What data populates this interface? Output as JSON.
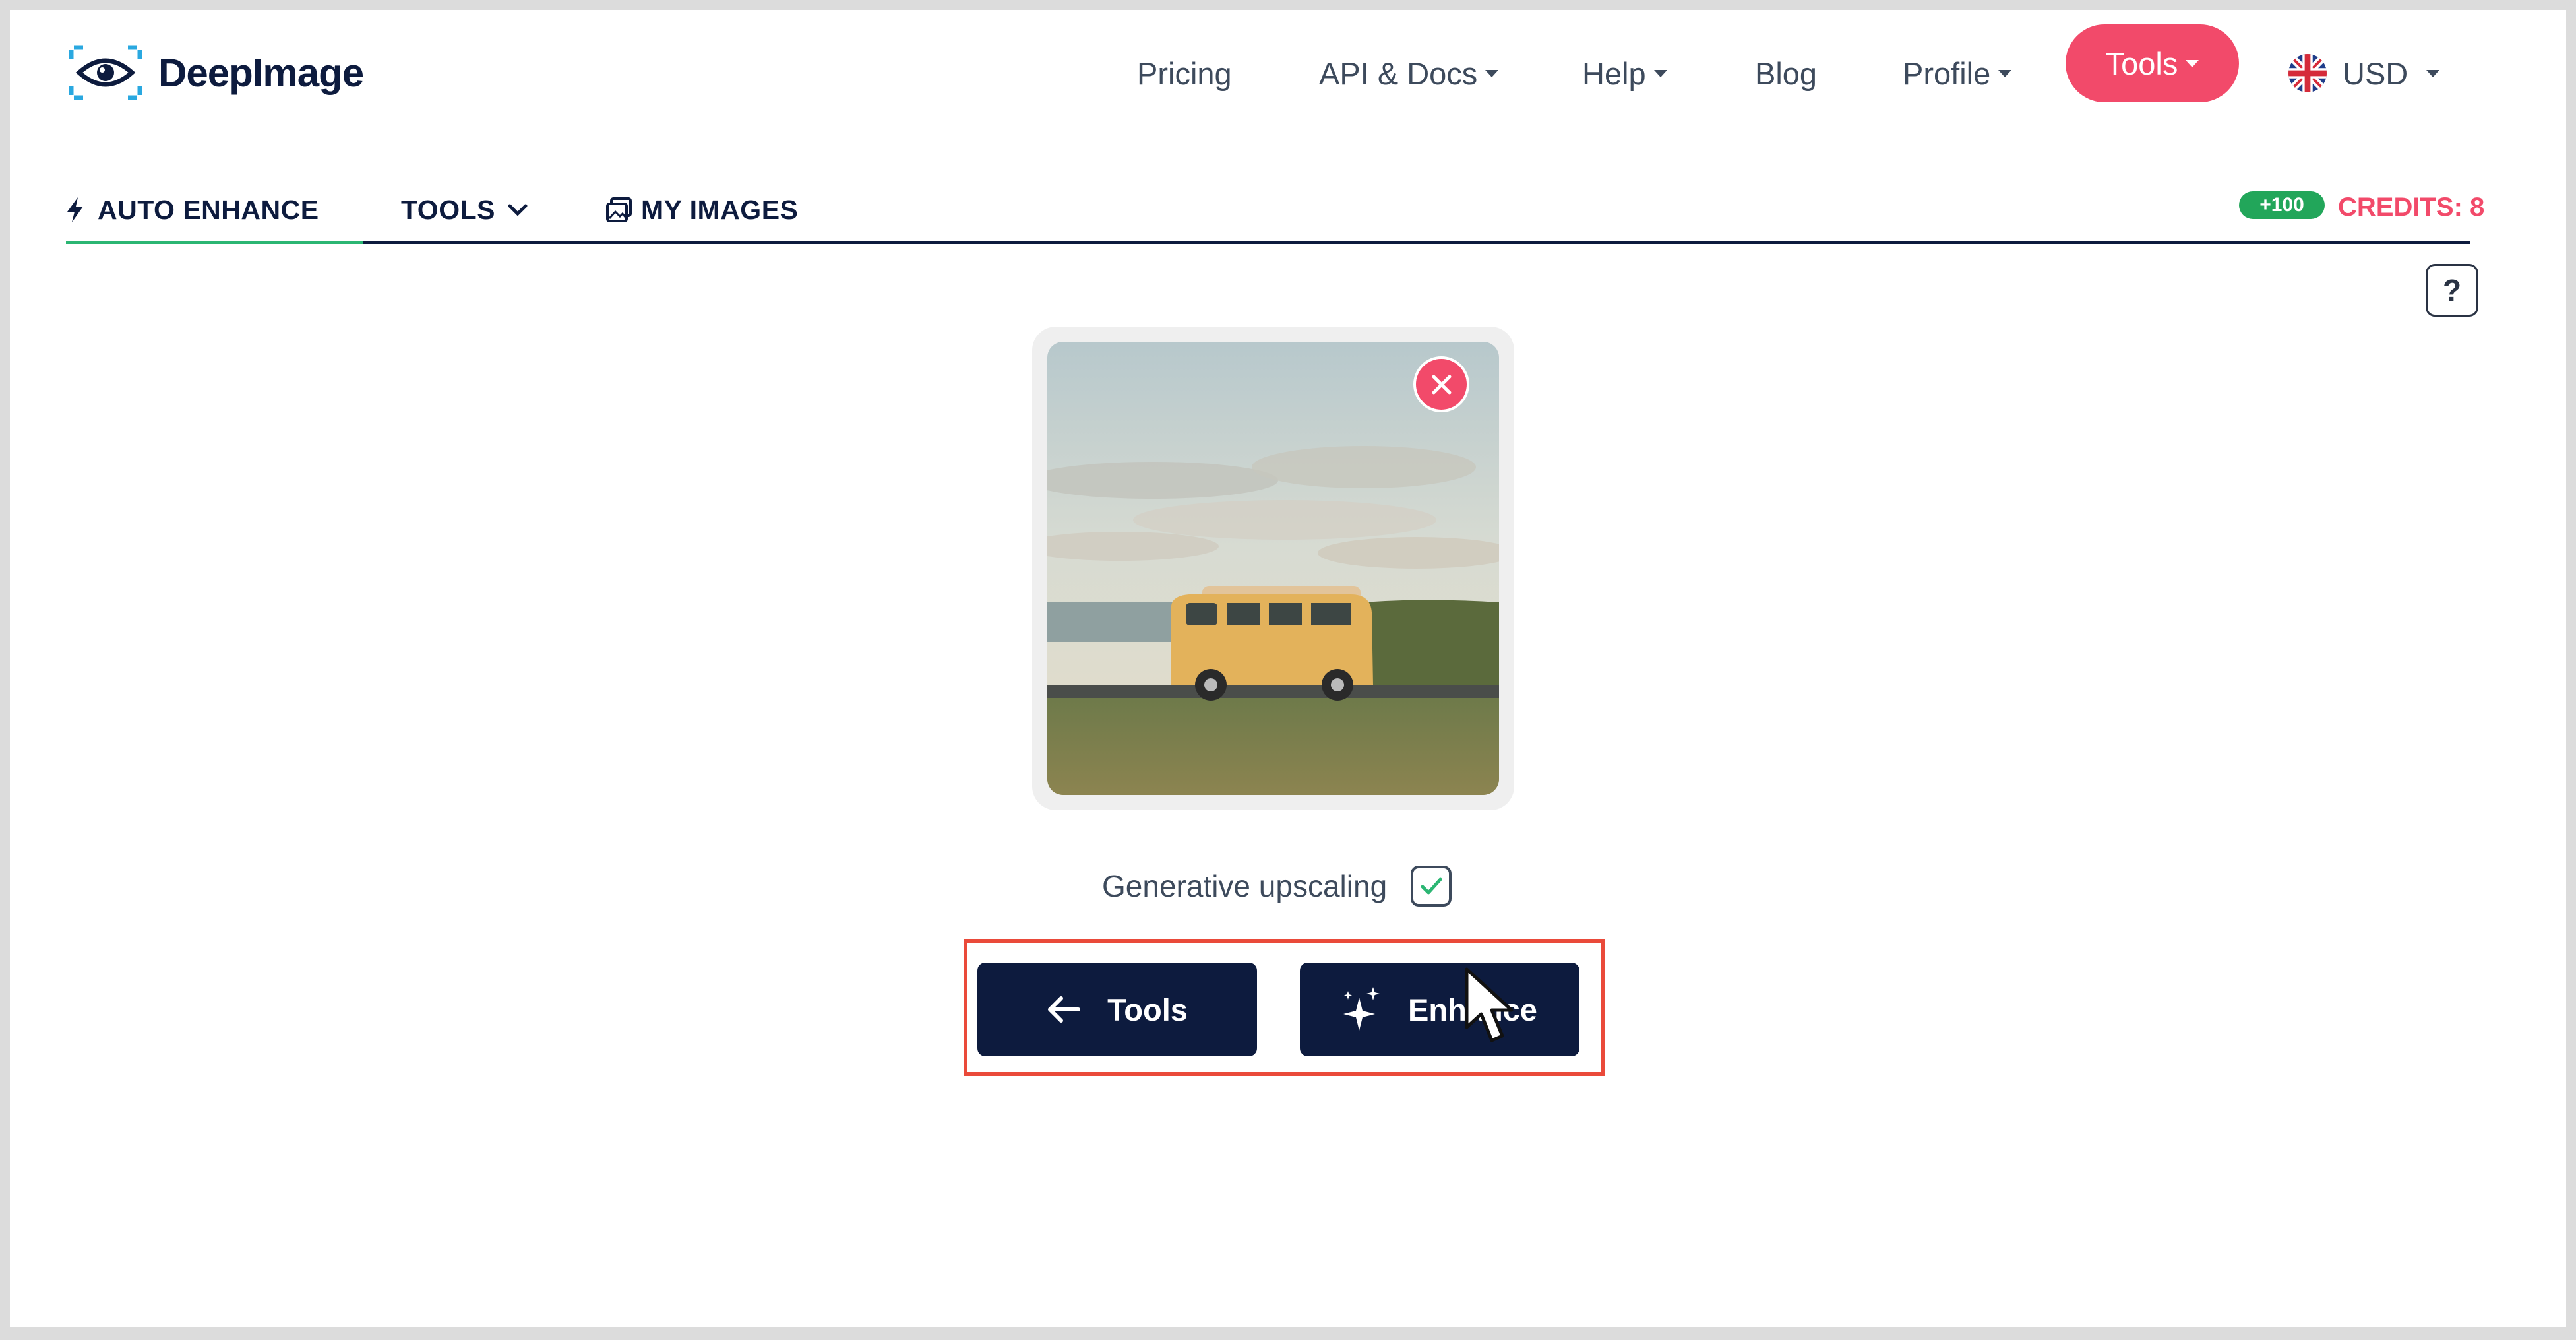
{
  "brand": {
    "name": "DeepImage"
  },
  "nav": {
    "pricing": "Pricing",
    "api_docs": "API & Docs",
    "help": "Help",
    "blog": "Blog",
    "profile": "Profile",
    "tools": "Tools",
    "currency": "USD"
  },
  "tabs": {
    "auto_enhance": "AUTO ENHANCE",
    "tools": "TOOLS",
    "my_images": "MY IMAGES"
  },
  "credits": {
    "badge": "+100",
    "label": "CREDITS: 8"
  },
  "help_button": "?",
  "upload": {
    "generative_label": "Generative upscaling",
    "generative_checked": true
  },
  "actions": {
    "back_label": "Tools",
    "enhance_label": "Enhance"
  },
  "colors": {
    "accent": "#f24a6a",
    "navy": "#0d1b3e",
    "green": "#2bb673",
    "highlight": "#ea4a3a"
  }
}
